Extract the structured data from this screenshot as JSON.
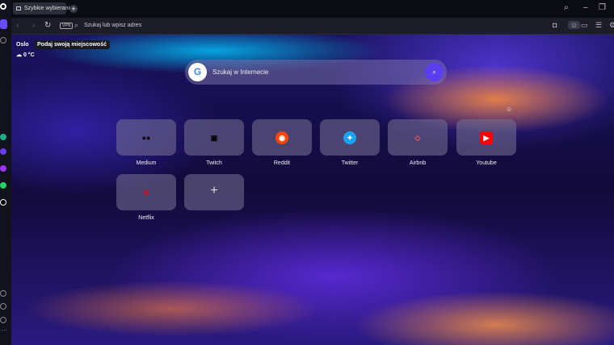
{
  "tabs": [
    {
      "label": "Szybkie wybieranie"
    }
  ],
  "address_bar": {
    "vpn": "VPN",
    "placeholder": "Szukaj lub wpisz adres"
  },
  "weather": {
    "city": "Oslo",
    "tooltip": "Podaj swoją miejscowość",
    "temperature": "0 °C"
  },
  "search": {
    "placeholder": "Szukaj w Internecie",
    "engine": "G"
  },
  "speed_dial": [
    {
      "label": "Medium",
      "glyph": "●●",
      "color": "#000000"
    },
    {
      "label": "Twitch",
      "glyph": "▣",
      "color": "#000000"
    },
    {
      "label": "Reddit",
      "glyph": "◉",
      "color": "#ff4500"
    },
    {
      "label": "Twitter",
      "glyph": "✦",
      "color": "#1da1f2"
    },
    {
      "label": "Airbnb",
      "glyph": "◇",
      "color": "#ff5a5f"
    },
    {
      "label": "Youtube",
      "glyph": "▶",
      "color": "#ff0000"
    },
    {
      "label": "Netflix",
      "glyph": "N",
      "color": "#e50914"
    }
  ],
  "add_site": "+"
}
